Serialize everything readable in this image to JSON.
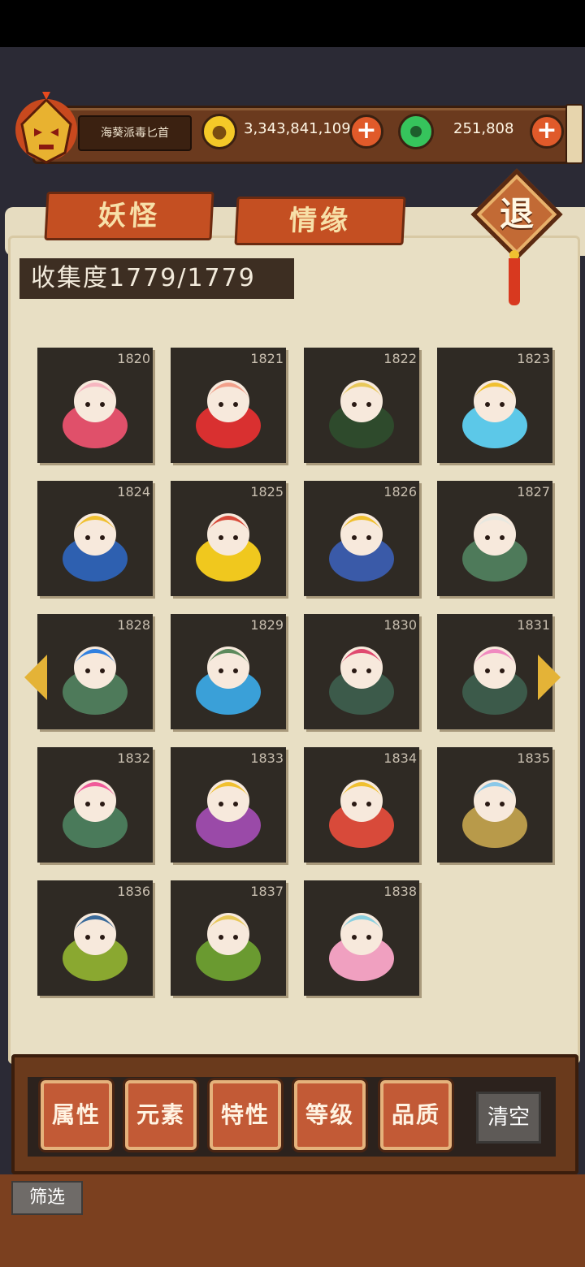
{
  "header": {
    "player_name": "海葵派毒匕首",
    "gold": "3,343,841,109",
    "jade": "251,808"
  },
  "tabs": [
    "妖怪",
    "情缘"
  ],
  "exit_label": "退",
  "collection_label": "收集度1779/1779",
  "cards": [
    {
      "id": "1820",
      "color": "#e0506a",
      "accent": "#f6b6c0"
    },
    {
      "id": "1821",
      "color": "#d93030",
      "accent": "#f2a08a"
    },
    {
      "id": "1822",
      "color": "#2e4a2c",
      "accent": "#e8c85a"
    },
    {
      "id": "1823",
      "color": "#5cc8e8",
      "accent": "#f0c030"
    },
    {
      "id": "1824",
      "color": "#2e60b0",
      "accent": "#f0c030"
    },
    {
      "id": "1825",
      "color": "#f0c81e",
      "accent": "#d84a3a"
    },
    {
      "id": "1826",
      "color": "#3a5aa8",
      "accent": "#f0c030"
    },
    {
      "id": "1827",
      "color": "#4e7a5a",
      "accent": "#e8e8e0"
    },
    {
      "id": "1828",
      "color": "#4e7a5a",
      "accent": "#3080e0"
    },
    {
      "id": "1829",
      "color": "#3aa0d8",
      "accent": "#5c8a5c"
    },
    {
      "id": "1830",
      "color": "#3c5a4a",
      "accent": "#e04a70"
    },
    {
      "id": "1831",
      "color": "#3c5a4a",
      "accent": "#f08ac0"
    },
    {
      "id": "1832",
      "color": "#4a7a5a",
      "accent": "#f05a9a"
    },
    {
      "id": "1833",
      "color": "#9a4aa8",
      "accent": "#f0c030"
    },
    {
      "id": "1834",
      "color": "#d84a3a",
      "accent": "#f0c030"
    },
    {
      "id": "1835",
      "color": "#b89a4a",
      "accent": "#8ac8e8"
    },
    {
      "id": "1836",
      "color": "#8aa830",
      "accent": "#3a6a9a"
    },
    {
      "id": "1837",
      "color": "#6a9a30",
      "accent": "#e8c85a"
    },
    {
      "id": "1838",
      "color": "#f0a0c0",
      "accent": "#8ad0e0"
    }
  ],
  "filters": [
    "属性",
    "元素",
    "特性",
    "等级",
    "品质"
  ],
  "clear_label": "清空",
  "filter_label": "筛选"
}
